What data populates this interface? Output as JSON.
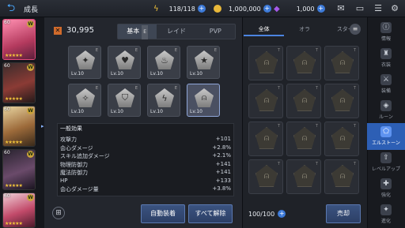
{
  "header": {
    "title": "成長",
    "stamina": "118/118",
    "gold": "1,000,000",
    "gems": "1,000"
  },
  "colors": {
    "accent": "#3d7ad8",
    "panel": "#23262d",
    "active_menu": "#2d5fb5"
  },
  "heroes": [
    {
      "level": "60",
      "badge": "W",
      "stars": "★★★★★"
    },
    {
      "level": "60",
      "badge": "W",
      "stars": "★★★★★"
    },
    {
      "level": "60",
      "badge": "W",
      "stars": "★★★★★"
    },
    {
      "level": "60",
      "badge": "W",
      "stars": "★★★★★"
    },
    {
      "level": "60",
      "badge": "W",
      "stars": "★★★★★"
    }
  ],
  "power": "30,995",
  "mid_tabs": {
    "basic": "基本",
    "basic_tag": "E",
    "raid": "レイド",
    "pvp": "PVP"
  },
  "slots": [
    {
      "icon": "butterfly-icon",
      "glyph": "✦",
      "level": "Lv.10",
      "tag": "E"
    },
    {
      "icon": "heart-icon",
      "glyph": "♥",
      "level": "Lv.10",
      "tag": "E"
    },
    {
      "icon": "flame-icon",
      "glyph": "♨",
      "level": "Lv.10",
      "tag": "E"
    },
    {
      "icon": "star-icon",
      "glyph": "★",
      "level": "Lv.10",
      "tag": "E"
    },
    {
      "icon": "compass-icon",
      "glyph": "✧",
      "level": "Lv.10",
      "tag": "E"
    },
    {
      "icon": "shield-icon",
      "glyph": "⛉",
      "level": "Lv.10",
      "tag": "E"
    },
    {
      "icon": "lightning-icon",
      "glyph": "ϟ",
      "level": "Lv.10",
      "tag": "E"
    },
    {
      "icon": "helmet-icon",
      "glyph": "⍝",
      "level": "Lv.10",
      "tag": ""
    }
  ],
  "effects": {
    "title": "一般効果",
    "rows": [
      {
        "name": "攻撃力",
        "value": "+101"
      },
      {
        "name": "会心ダメージ",
        "value": "+2.8%"
      },
      {
        "name": "スキル追加ダメージ",
        "value": "+2.1%"
      },
      {
        "name": "物理防御力",
        "value": "+141"
      },
      {
        "name": "魔法防御力",
        "value": "+141"
      },
      {
        "name": "HP",
        "value": "+133"
      },
      {
        "name": "会心ダメージ量",
        "value": "+3.8%"
      }
    ]
  },
  "buttons": {
    "auto_equip": "自動装着",
    "unequip_all": "すべて解除",
    "sell": "売却"
  },
  "right_tabs": {
    "all": "全体",
    "ora": "オラ",
    "star": "スター"
  },
  "inventory": {
    "capacity": "100/100",
    "count": 12,
    "lock_tag": "T"
  },
  "side_menu": [
    {
      "icon": "info-icon",
      "glyph": "ⓘ",
      "label": "情報"
    },
    {
      "icon": "costume-icon",
      "glyph": "♜",
      "label": "衣装"
    },
    {
      "icon": "equipment-icon",
      "glyph": "⚔",
      "label": "装備"
    },
    {
      "icon": "rune-icon",
      "glyph": "◈",
      "label": "ルーン"
    },
    {
      "icon": "elstone-icon",
      "glyph": "⬠",
      "label": "エルストーン"
    },
    {
      "icon": "levelup-icon",
      "glyph": "⇧",
      "label": "レベルアップ"
    },
    {
      "icon": "enhance-icon",
      "glyph": "✚",
      "label": "強化"
    },
    {
      "icon": "evolve-icon",
      "glyph": "✦",
      "label": "進化"
    }
  ]
}
